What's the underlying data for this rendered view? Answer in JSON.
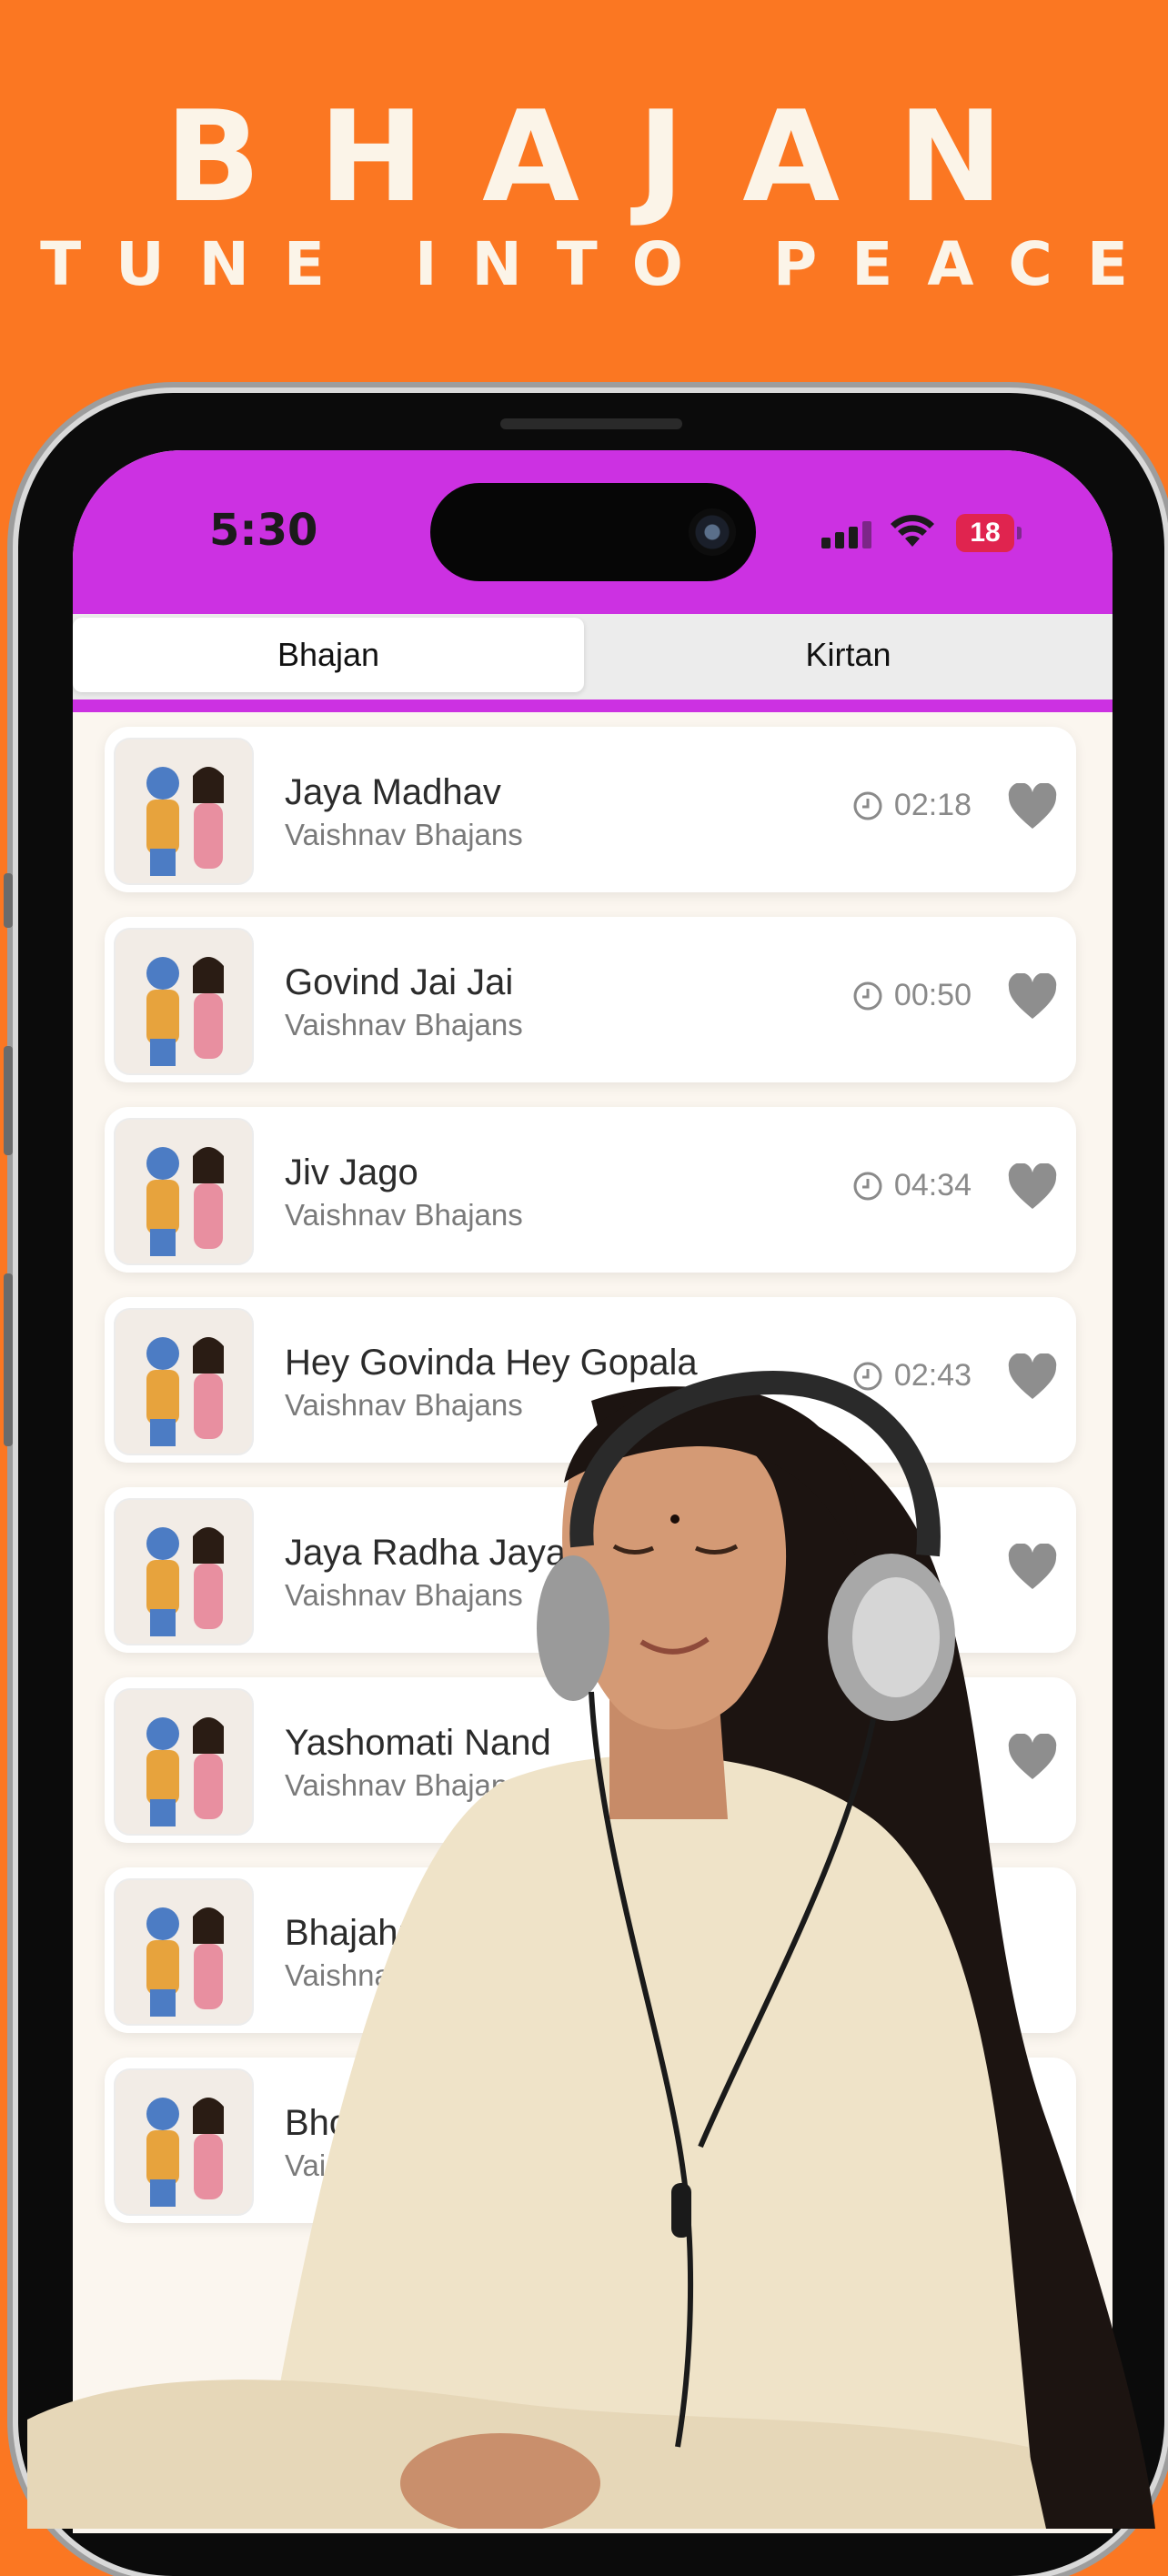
{
  "hero": {
    "title": "BHAJAN",
    "subtitle": "TUNE INTO PEACE"
  },
  "status_bar": {
    "time": "5:30",
    "battery": "18"
  },
  "tabs": [
    {
      "label": "Bhajan",
      "selected": true
    },
    {
      "label": "Kirtan",
      "selected": false
    }
  ],
  "songs": [
    {
      "title": "Jaya Madhav",
      "artist": "Vaishnav Bhajans",
      "duration": "02:18"
    },
    {
      "title": "Govind Jai Jai",
      "artist": "Vaishnav Bhajans",
      "duration": "00:50"
    },
    {
      "title": "Jiv Jago",
      "artist": "Vaishnav Bhajans",
      "duration": "04:34"
    },
    {
      "title": "Hey Govinda Hey Gopala",
      "artist": "Vaishnav Bhajans",
      "duration": "02:43"
    },
    {
      "title": "Jaya Radha Jaya",
      "artist": "Vaishnav Bhajans",
      "duration": ""
    },
    {
      "title": "Yashomati Nand",
      "artist": "Vaishnav Bhajans",
      "duration": ""
    },
    {
      "title": "Bhajahu R",
      "artist": "Vaishnav B",
      "duration": ""
    },
    {
      "title": "Bhoga A",
      "artist": "Vaishnav",
      "duration": ""
    }
  ],
  "colors": {
    "background": "#fb7722",
    "status_bar": "#cc31e2",
    "heart": "#8e8e8e"
  }
}
